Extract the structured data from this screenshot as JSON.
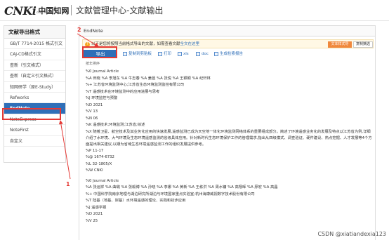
{
  "header": {
    "logo_mark": "CNKi",
    "logo_cn": "中国知网",
    "logo_sub": "cnki.net",
    "title": "文献管理中心-文献输出"
  },
  "sidebar": {
    "title": "文献导出格式",
    "items": [
      {
        "label": "GB/T 7714-2015 格式引文"
      },
      {
        "label": "CAJ-CD格式引文"
      },
      {
        "label": "查新（引文格式）"
      },
      {
        "label": "查新（自定义引文格式）"
      },
      {
        "label": "知网研学（原E-Study）"
      },
      {
        "label": "Refworks"
      },
      {
        "label": "EndNote"
      },
      {
        "label": "NoteExpress"
      },
      {
        "label": "NoteFirst"
      },
      {
        "label": "自定义"
      }
    ]
  },
  "main": {
    "tab": "EndNote",
    "notice": {
      "icon": "!",
      "text": "以下是您将按照当前格式导出的文献，如需查看文献",
      "link": "全文在这里",
      "orange_button": "文本样式导",
      "white_button": "复制摘选"
    },
    "toolbar": {
      "export": "导出",
      "copy": "复制到剪贴板",
      "print": "打印",
      "xls": "xls",
      "doc": "doc",
      "report": "生成检索报告"
    },
    "sort_hint": "按年排序"
  },
  "records": [
    "%0 Journal Article",
    "%A 田晓 %A 李旭东 %A 牛志春 %A 姜晨 %A 张悦 %A 王颖颖 %A 纪轩林",
    "%+ 江苏省环境监测中心;江苏省生态环境监测监控有限公司",
    "%T 遥感技术在环境监测中的应用进展与思考",
    "%J 环境监控与预警",
    "%D 2021",
    "%V 13",
    "%N 06",
    "%K 遥感技术;环境监测;江苏省;综述",
    "%X 随着卫星、航空技术及其业务化应用的快速发展,遥感监测已成为天空地一体化环境监测网络体系的重要组成部分。简述了环境遥感业务化的发展及特点以江苏省为例,详细介绍了水环境、大气环境及生态环境遥感监测的省级具体应用。针对新时代生态环境保护工作的管理需求,指出从四级模式、调查验证、硬件建设、热点挖掘、人才发展等4个方面提出相关建议,以期为省域生态环境遥感监测工作的组织发展提供参考。",
    "%P 11-17",
    "%@ 1674-6732",
    "%L 32-1805/X",
    "%W CNKI",
    "",
    "%0 Journal Article",
    "%A 张运祥 %A 曲璐 %A 张毅博 %A 孙晓 %A 李娜 %A 黄新 %A 王栋洪 %A 周水镛 %A 高翔晖 %A 廖宏 %A 高晶",
    "%+ 中国科学院南京地理与湖泊研究所湖泊与环境国家重点实验室;杭州海康威视数字技术股份有限公司",
    "%T 陆基（地基、岸基）水环境遥感的理论、实践和初步应用",
    "%J 遥感学报",
    "%D 2021",
    "%V 25"
  ],
  "annotations": {
    "step1": "1",
    "step2": "2"
  },
  "watermark": "CSDN @xiatiandexia123",
  "colors": {
    "accent": "#2f6fb8",
    "annotation": "#e53935",
    "notice_button": "#f0883c"
  }
}
